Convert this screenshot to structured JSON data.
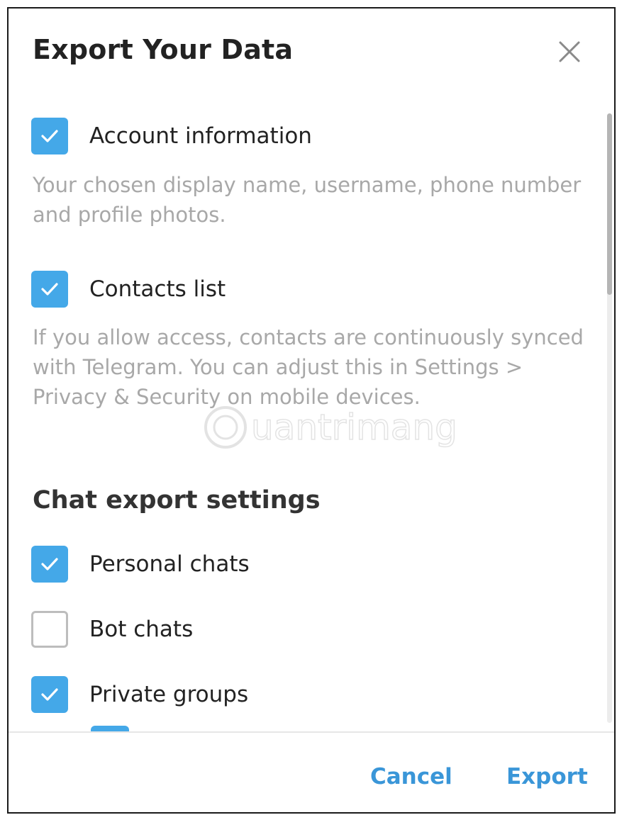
{
  "dialog": {
    "title": "Export Your Data"
  },
  "account": {
    "label": "Account information",
    "checked": true,
    "description": "Your chosen display name, username, phone number and profile photos."
  },
  "contacts": {
    "label": "Contacts list",
    "checked": true,
    "description": "If you allow access, contacts are continuously synced with Telegram. You can adjust this in Settings > Privacy & Security on mobile devices."
  },
  "chat_settings": {
    "title": "Chat export settings",
    "items": [
      {
        "label": "Personal chats",
        "checked": true
      },
      {
        "label": "Bot chats",
        "checked": false
      },
      {
        "label": "Private groups",
        "checked": true
      }
    ]
  },
  "footer": {
    "cancel_label": "Cancel",
    "export_label": "Export"
  },
  "watermark": {
    "text": "uantrimang"
  },
  "colors": {
    "accent": "#44a8e8",
    "button_text": "#3a96d8",
    "description_text": "#a8a8a8"
  },
  "icons": {
    "close": "close-icon",
    "check": "checkmark-icon"
  }
}
